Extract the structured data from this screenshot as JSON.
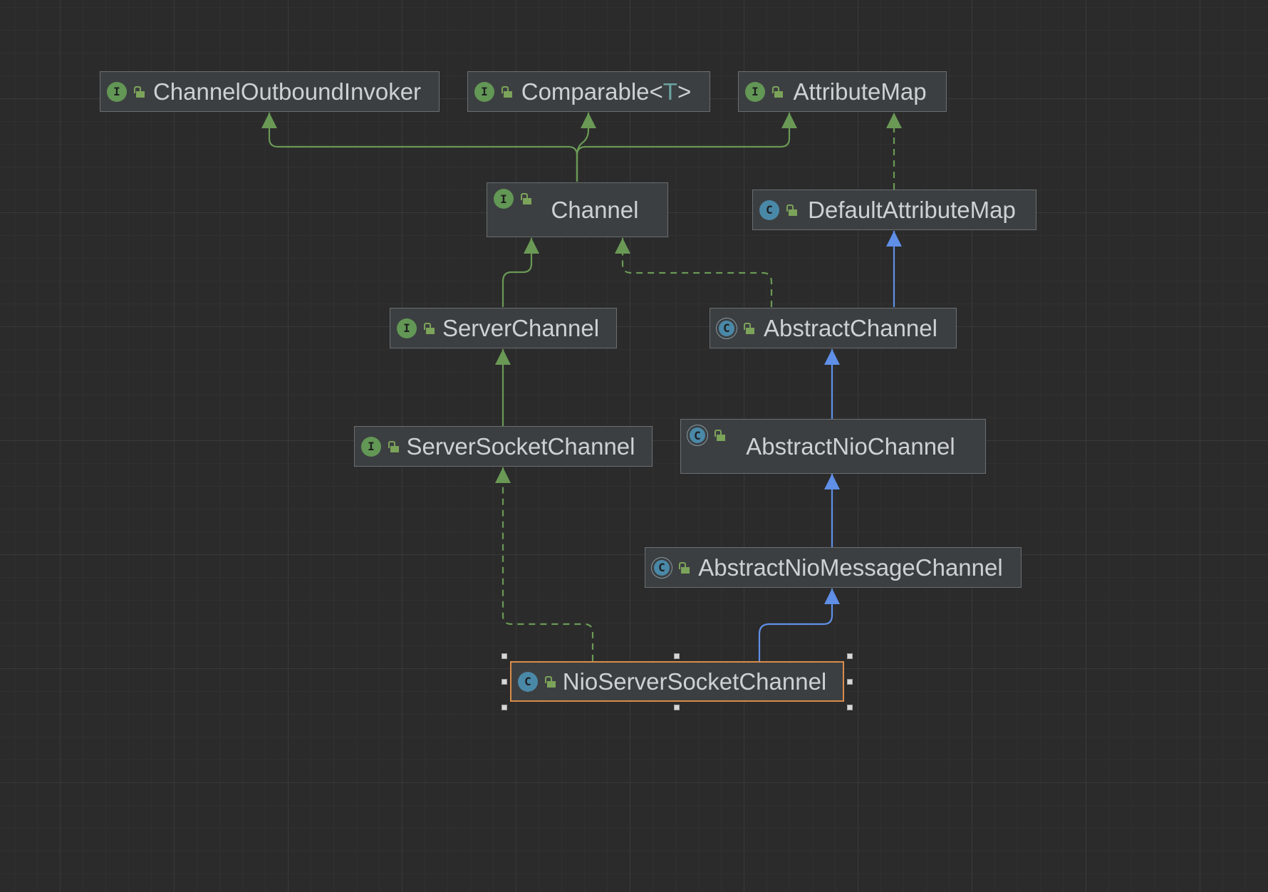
{
  "nodes": {
    "channel_outbound_invoker": {
      "label": "ChannelOutboundInvoker",
      "kind": "I"
    },
    "comparable": {
      "label": "Comparable",
      "type_open": "<",
      "type_param": "T",
      "type_close": ">",
      "kind": "I"
    },
    "attribute_map": {
      "label": "AttributeMap",
      "kind": "I"
    },
    "channel": {
      "label": "Channel",
      "kind": "I"
    },
    "default_attribute_map": {
      "label": "DefaultAttributeMap",
      "kind": "C"
    },
    "server_channel": {
      "label": "ServerChannel",
      "kind": "I"
    },
    "abstract_channel": {
      "label": "AbstractChannel",
      "kind": "C"
    },
    "server_socket_channel": {
      "label": "ServerSocketChannel",
      "kind": "I"
    },
    "abstract_nio_channel": {
      "label": "AbstractNioChannel",
      "kind": "C"
    },
    "abstract_nio_message_channel": {
      "label": "AbstractNioMessageChannel",
      "kind": "C"
    },
    "nio_server_socket_channel": {
      "label": "NioServerSocketChannel",
      "kind": "C"
    }
  },
  "colors": {
    "interface_edge": "#6a9955",
    "class_edge": "#5f8fe6",
    "selection": "#d98c4a"
  },
  "icons": {
    "interface": "interface-icon",
    "class": "class-icon",
    "abstract_class": "abstract-class-icon",
    "visibility": "public-lock-icon"
  }
}
